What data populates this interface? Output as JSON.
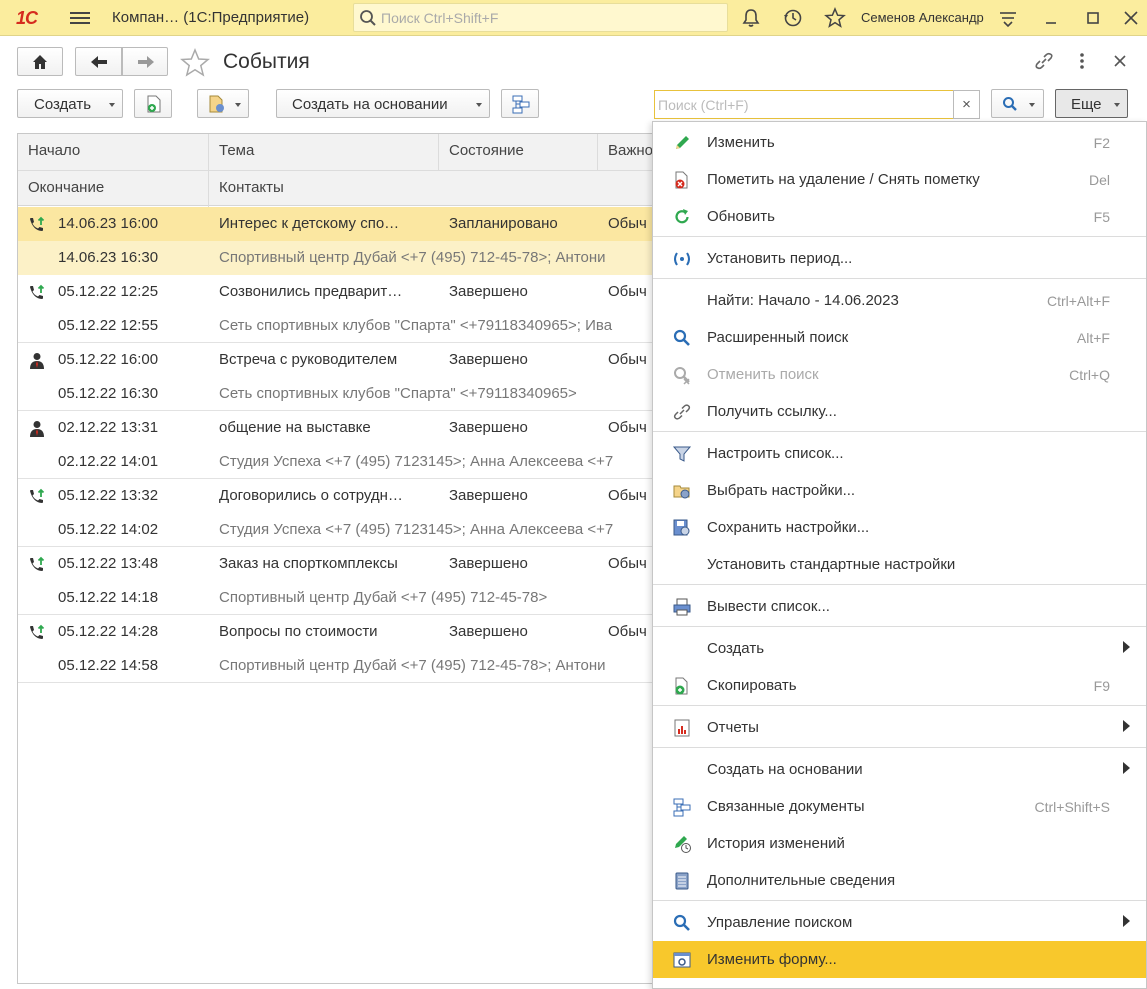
{
  "topbar": {
    "logo": "1С",
    "app_title": "Компан…  (1С:Предприятие)",
    "search_placeholder": "Поиск Ctrl+Shift+F",
    "user": "Семенов Александр"
  },
  "window": {
    "title": "События",
    "create_label": "Создать",
    "create_based_label": "Создать на основании",
    "search_placeholder": "Поиск (Ctrl+F)",
    "clear_label": "×",
    "more_label": "Еще"
  },
  "grid": {
    "headers_row1": [
      "Начало",
      "Тема",
      "Состояние",
      "Важно"
    ],
    "headers_row2": [
      "Окончание",
      "Контакты"
    ],
    "rows": [
      {
        "icon": "phone-call-icon",
        "start": "14.06.23 16:00",
        "subject": "Интерес к детскому спо…",
        "state": "Запланировано",
        "importance": "Обыч",
        "end": "14.06.23 16:30",
        "contacts": "Спортивный центр Дубай <+7 (495) 712-45-78>; Антони",
        "selected": true
      },
      {
        "icon": "phone-call-icon",
        "start": "05.12.22 12:25",
        "subject": "Созвонились предварит…",
        "state": "Завершено",
        "importance": "Обыч",
        "end": "05.12.22 12:55",
        "contacts": "Сеть спортивных клубов \"Спарта\" <+79118340965>; Ива",
        "selected": false
      },
      {
        "icon": "meeting-icon",
        "start": "05.12.22 16:00",
        "subject": "Встреча с руководителем",
        "state": "Завершено",
        "importance": "Обыч",
        "end": "05.12.22 16:30",
        "contacts": "Сеть спортивных клубов \"Спарта\" <+79118340965>",
        "selected": false
      },
      {
        "icon": "meeting-icon",
        "start": "02.12.22 13:31",
        "subject": "общение на выставке",
        "state": "Завершено",
        "importance": "Обыч",
        "end": "02.12.22 14:01",
        "contacts": "Студия Успеха <+7 (495) 7123145>; Анна Алексеева <+7",
        "selected": false
      },
      {
        "icon": "phone-call-icon",
        "start": "05.12.22 13:32",
        "subject": "Договорились о сотрудн…",
        "state": "Завершено",
        "importance": "Обыч",
        "end": "05.12.22 14:02",
        "contacts": "Студия Успеха <+7 (495) 7123145>; Анна Алексеева <+7",
        "selected": false
      },
      {
        "icon": "phone-call-icon",
        "start": "05.12.22 13:48",
        "subject": "Заказ на спорткомплексы",
        "state": "Завершено",
        "importance": "Обыч",
        "end": "05.12.22 14:18",
        "contacts": "Спортивный центр Дубай <+7 (495) 712-45-78>",
        "selected": false
      },
      {
        "icon": "phone-call-icon",
        "start": "05.12.22 14:28",
        "subject": "Вопросы по стоимости",
        "state": "Завершено",
        "importance": "Обыч",
        "end": "05.12.22 14:58",
        "contacts": "Спортивный центр Дубай <+7 (495) 712-45-78>; Антони",
        "selected": false
      }
    ]
  },
  "menu": {
    "items": [
      {
        "label": "Изменить",
        "shortcut": "F2",
        "icon": "pencil-icon"
      },
      {
        "label": "Пометить на удаление / Снять пометку",
        "shortcut": "Del",
        "icon": "delete-mark-icon"
      },
      {
        "label": "Обновить",
        "shortcut": "F5",
        "icon": "refresh-icon"
      },
      {
        "label": "Установить период...",
        "shortcut": "",
        "icon": "period-icon"
      },
      {
        "label": "Найти: Начало - 14.06.2023",
        "shortcut": "Ctrl+Alt+F",
        "icon": ""
      },
      {
        "label": "Расширенный поиск",
        "shortcut": "Alt+F",
        "icon": "advanced-search-icon"
      },
      {
        "label": "Отменить поиск",
        "shortcut": "Ctrl+Q",
        "icon": "cancel-search-icon",
        "disabled": true
      },
      {
        "label": "Получить ссылку...",
        "shortcut": "",
        "icon": "link-icon"
      },
      {
        "label": "Настроить список...",
        "shortcut": "",
        "icon": "list-settings-icon"
      },
      {
        "label": "Выбрать настройки...",
        "shortcut": "",
        "icon": "load-settings-icon"
      },
      {
        "label": "Сохранить настройки...",
        "shortcut": "",
        "icon": "save-settings-icon"
      },
      {
        "label": "Установить стандартные настройки",
        "shortcut": "",
        "icon": ""
      },
      {
        "label": "Вывести список...",
        "shortcut": "",
        "icon": "print-list-icon"
      },
      {
        "label": "Создать",
        "shortcut": "",
        "icon": "",
        "submenu": true
      },
      {
        "label": "Скопировать",
        "shortcut": "F9",
        "icon": "copy-icon"
      },
      {
        "label": "Отчеты",
        "shortcut": "",
        "icon": "reports-icon",
        "submenu": true
      },
      {
        "label": "Создать на основании",
        "shortcut": "",
        "icon": "",
        "submenu": true
      },
      {
        "label": "Связанные документы",
        "shortcut": "Ctrl+Shift+S",
        "icon": "related-docs-icon"
      },
      {
        "label": "История изменений",
        "shortcut": "",
        "icon": "history-icon"
      },
      {
        "label": "Дополнительные сведения",
        "shortcut": "",
        "icon": "additional-info-icon"
      },
      {
        "label": "Управление поиском",
        "shortcut": "",
        "icon": "search-control-icon",
        "submenu": true
      },
      {
        "label": "Изменить форму...",
        "shortcut": "",
        "icon": "change-form-icon",
        "highlighted": true
      }
    ]
  },
  "colors": {
    "topbar_bg": "#fbed9e",
    "selection_row": "#fbe7a1",
    "menu_highlight": "#f8c82c",
    "accent_green": "#2fa84f",
    "accent_blue": "#2a6db5"
  }
}
